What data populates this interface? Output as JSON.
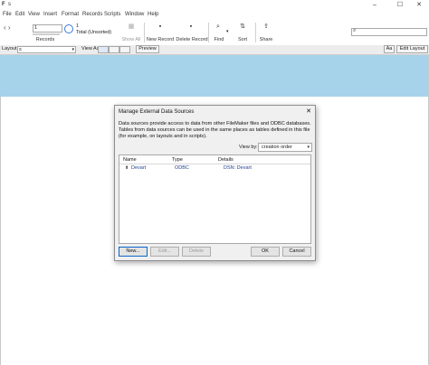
{
  "window": {
    "app_icon": "F",
    "title": "s",
    "minimize": "–",
    "maximize": "☐",
    "close": "✕"
  },
  "menu": [
    "File",
    "Edit",
    "View",
    "Insert",
    "Format",
    "Records",
    "Scripts",
    "Window",
    "Help"
  ],
  "toolbar": {
    "record_number": "1",
    "records_label": "Records",
    "found_count": "1",
    "total_label": "Total (Unsorted)",
    "show_all": "Show All",
    "new_record": "New Record",
    "delete_record": "Delete Record",
    "find": "Find",
    "sort": "Sort",
    "share": "Share"
  },
  "layoutbar": {
    "layout_label": "Layout:",
    "layout_value": "s",
    "view_as_label": "View As:",
    "preview": "Preview",
    "aa": "Aa",
    "edit_layout": "Edit Layout"
  },
  "dialog": {
    "title": "Manage External Data Sources",
    "close": "✕",
    "description": "Data sources provide access to data from other FileMaker files and ODBC databases. Tables from data sources can be used in the same places as tables defined in this file (for example, on layouts and in scripts).",
    "view_by_label": "View by:",
    "view_by_value": "creation order",
    "columns": [
      "Name",
      "Type",
      "Details"
    ],
    "rows": [
      {
        "name": "Devart",
        "type": "ODBC",
        "details": "DSN: Devart"
      }
    ],
    "buttons": {
      "new": "New...",
      "edit": "Edit...",
      "delete": "Delete",
      "ok": "OK",
      "cancel": "Cancel"
    }
  },
  "colors": {
    "header_band": "#a7d3ea",
    "dialog_bg": "#f0f0f0",
    "link_blue": "#1f3f8f"
  }
}
